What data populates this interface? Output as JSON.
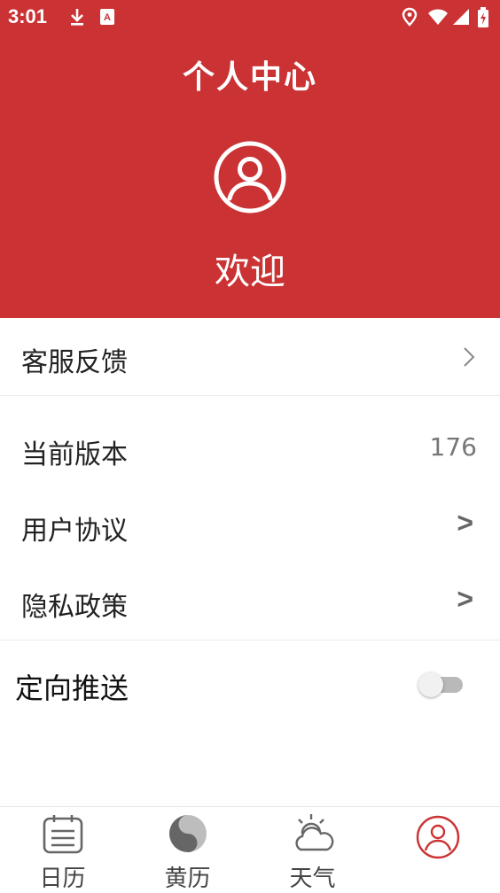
{
  "status_bar": {
    "time": "3:01",
    "icons": [
      "download-icon",
      "app-badge-icon",
      "location-icon",
      "wifi-icon",
      "signal-icon",
      "battery-icon"
    ]
  },
  "header": {
    "title": "个人中心",
    "avatar_icon": "user-circle-icon",
    "welcome": "欢迎",
    "background_color": "#cb3234"
  },
  "menu": {
    "feedback": {
      "label": "客服反馈",
      "icon": "chevron-right-icon"
    },
    "version": {
      "label": "当前版本",
      "value": "176"
    },
    "agreement": {
      "label": "用户协议",
      "arrow": ">"
    },
    "privacy": {
      "label": "隐私政策",
      "arrow": ">"
    },
    "push": {
      "label": "定向推送",
      "enabled": false
    }
  },
  "tabbar": {
    "tabs": [
      {
        "label": "日历",
        "icon": "calendar-icon"
      },
      {
        "label": "黄历",
        "icon": "yin-yang-icon"
      },
      {
        "label": "天气",
        "icon": "weather-icon"
      },
      {
        "label": "",
        "icon": "user-icon",
        "active": true
      }
    ],
    "active_color": "#cb3234"
  }
}
